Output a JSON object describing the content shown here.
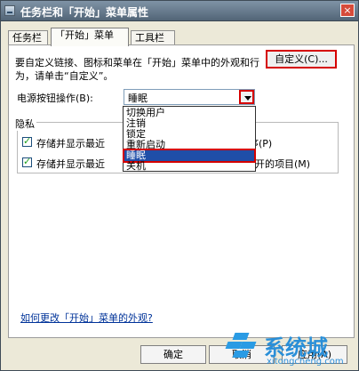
{
  "window": {
    "title": "任务栏和「开始」菜单属性",
    "close_symbol": "×"
  },
  "tabs": [
    {
      "label": "任务栏"
    },
    {
      "label": "「开始」菜单"
    },
    {
      "label": "工具栏"
    }
  ],
  "start_menu": {
    "description": "要自定义链接、图标和菜单在「开始」菜单中的外观和行为，请单击“自定义”。",
    "customize_button": "自定义(C)...",
    "power_label": "电源按钮操作(B):",
    "power_value": "睡眠",
    "power_options": [
      "切换用户",
      "注销",
      "锁定",
      "重新启动",
      "睡眠",
      "关机"
    ],
    "selected_option": "睡眠",
    "privacy_title": "隐私",
    "privacy_items": [
      {
        "label": "存储并显示最近",
        "tail": "序(P)"
      },
      {
        "label": "存储并显示最近",
        "tail": "开的项目(M)"
      }
    ],
    "help_link": "如何更改「开始」菜单的外观?"
  },
  "footer": {
    "ok": "确定",
    "cancel": "取消",
    "apply": "应用(A)"
  },
  "watermark": {
    "name": "系统城",
    "url": "xitongcheng.com"
  },
  "colors": {
    "highlight": "#d50000",
    "selection": "#1f4ea8",
    "link": "#003399"
  }
}
